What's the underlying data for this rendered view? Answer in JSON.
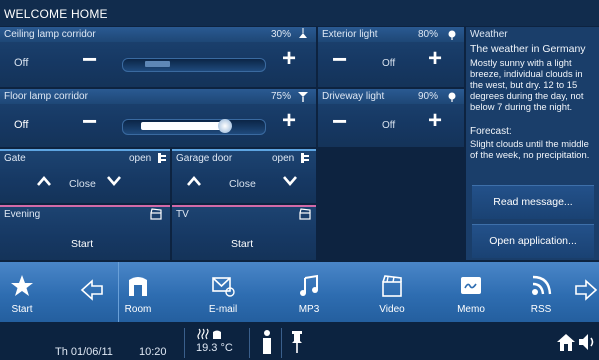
{
  "header": {
    "title": "WELCOME HOME"
  },
  "ceiling": {
    "title": "Ceiling lamp corridor",
    "value": "30%",
    "state": "Off",
    "level": 0.3
  },
  "floor": {
    "title": "Floor lamp corridor",
    "value": "75%",
    "state": "Off",
    "level": 0.75
  },
  "exterior": {
    "title": "Exterior light",
    "value": "80%",
    "state": "Off"
  },
  "driveway": {
    "title": "Driveway light",
    "value": "90%",
    "state": "Off"
  },
  "gate": {
    "title": "Gate",
    "status": "open",
    "action": "Close"
  },
  "garage": {
    "title": "Garage door",
    "status": "open",
    "action": "Close"
  },
  "evening": {
    "title": "Evening",
    "action": "Start"
  },
  "tv": {
    "title": "TV",
    "action": "Start"
  },
  "weather": {
    "title": "Weather",
    "headline": "The weather in Germany",
    "line1": "Mostly sunny with a light",
    "line2": "breeze, individual clouds in",
    "line3": "the west, but dry. 12 to 15",
    "line4": "degrees during the day, not",
    "line5": "below 7 during the night.",
    "forecast_label": "Forecast:",
    "forecast1": "Slight clouds until the middle",
    "forecast2": "of the week, no precipitation.",
    "read_button": "Read message...",
    "open_button": "Open application..."
  },
  "nav": {
    "start": "Start",
    "room": "Room",
    "email": "E-mail",
    "mp3": "MP3",
    "video": "Video",
    "memo": "Memo",
    "rss": "RSS"
  },
  "status": {
    "date": "Th 01/06/11",
    "time": "10:20",
    "temperature": "19.3 °C"
  },
  "colors": {
    "accent": "#2e6db1",
    "panel": "#1d4472",
    "background": "#0d2340"
  }
}
